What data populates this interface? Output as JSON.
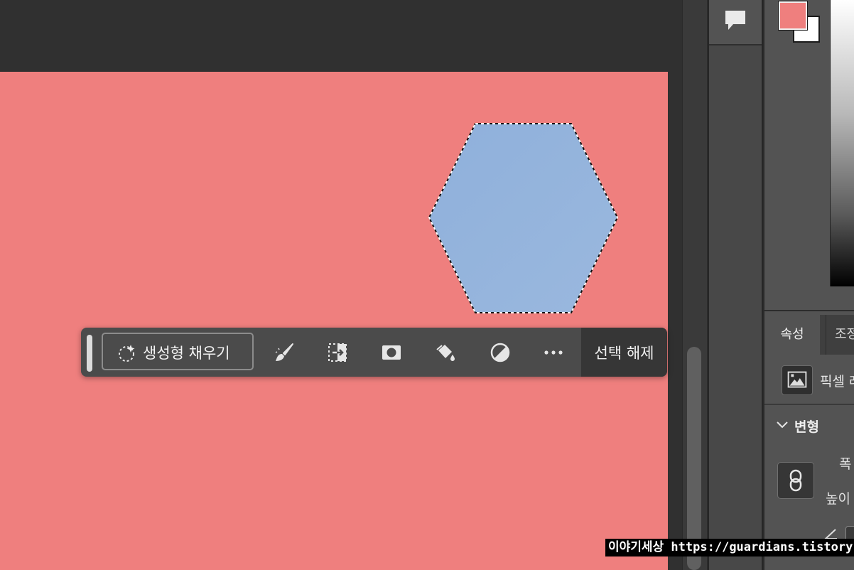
{
  "canvas": {
    "background_color": "#ef7f7e",
    "shape": "hexagon",
    "shape_fill": "#93b3dc",
    "selection": "marching-ants"
  },
  "task_bar": {
    "generative_fill_label": "생성형 채우기",
    "icons": [
      "brush-icon",
      "select-subject-icon",
      "mask-icon",
      "fill-bucket-icon",
      "adjustment-icon",
      "more-icon"
    ],
    "deselect_label": "선택 해제"
  },
  "color_panel": {
    "foreground_color": "#ef7f7e",
    "background_color": "#ffffff"
  },
  "properties_panel": {
    "tabs": [
      {
        "label": "속성",
        "active": true
      },
      {
        "label": "조정",
        "active": false
      }
    ],
    "layer_type_label": "픽셀 레이어",
    "transform_label": "변형",
    "width_label": "폭",
    "height_label": "높이"
  },
  "watermark": "이야기세상 https://guardians.tistory.com"
}
